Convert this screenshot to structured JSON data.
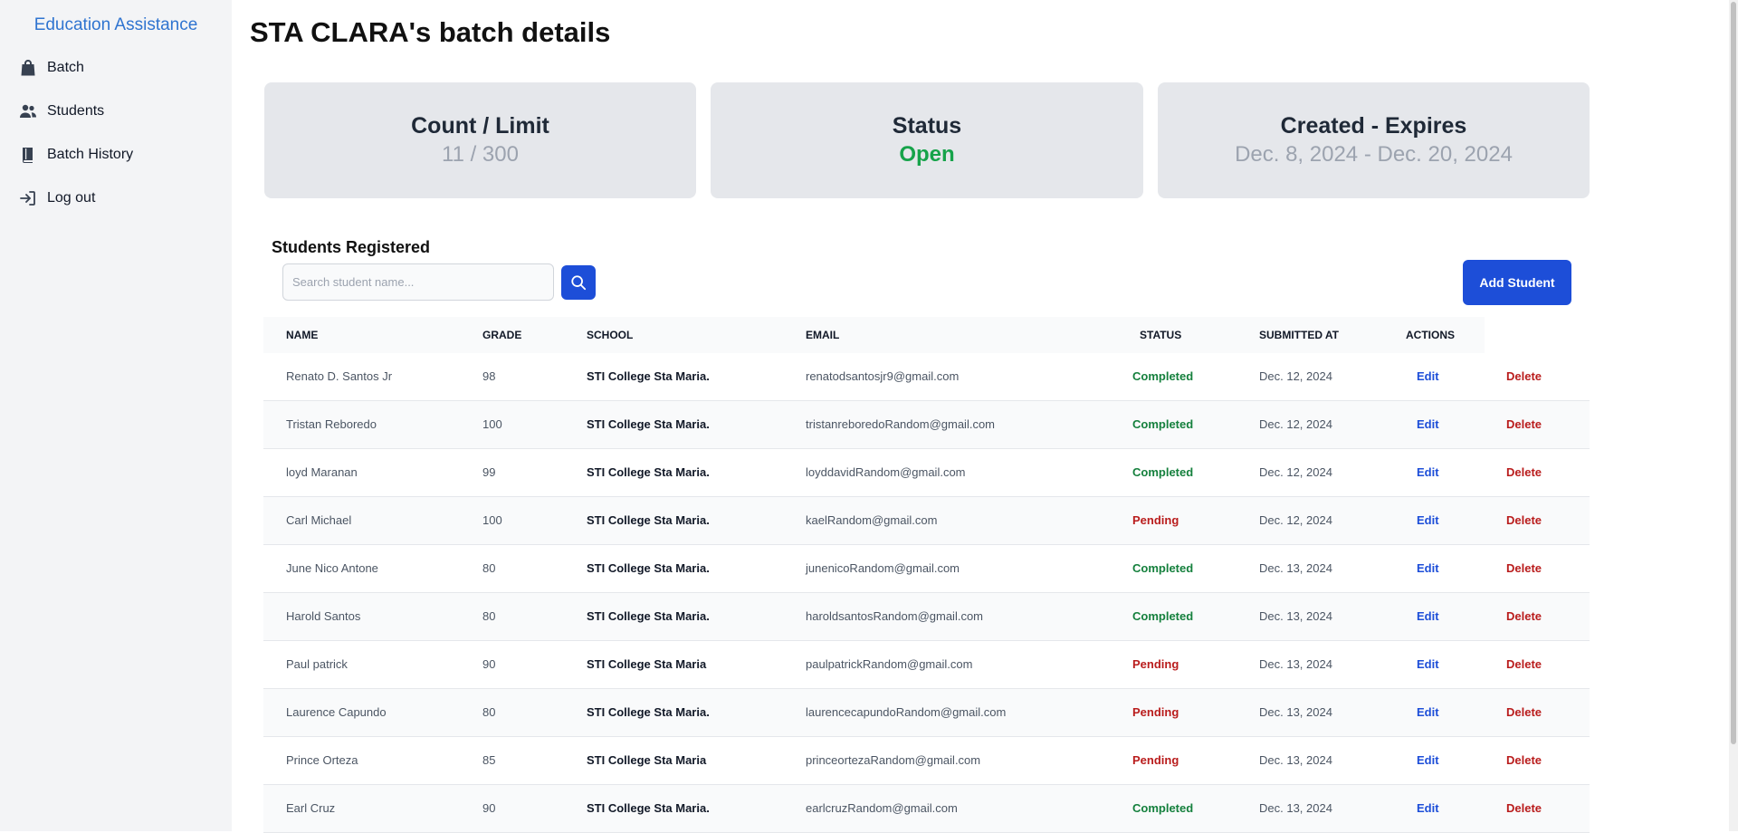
{
  "sidebar": {
    "brand": "Education Assistance",
    "items": [
      {
        "label": "Batch",
        "icon": "shopping-bag-icon"
      },
      {
        "label": "Students",
        "icon": "users-icon"
      },
      {
        "label": "Batch History",
        "icon": "book-icon"
      },
      {
        "label": "Log out",
        "icon": "logout-icon"
      }
    ]
  },
  "page": {
    "title": "STA CLARA's batch details"
  },
  "cards": [
    {
      "title": "Count / Limit",
      "value": "11 / 300"
    },
    {
      "title": "Status",
      "value": "Open"
    },
    {
      "title": "Created - Expires",
      "value": "Dec. 8, 2024 - Dec. 20, 2024"
    }
  ],
  "students": {
    "section_title": "Students Registered",
    "search_placeholder": "Search student name...",
    "add_button": "Add Student",
    "columns": [
      "NAME",
      "GRADE",
      "SCHOOL",
      "EMAIL",
      "STATUS",
      "SUBMITTED AT",
      "ACTIONS"
    ],
    "rows": [
      {
        "name": "Renato D. Santos Jr",
        "grade": "98",
        "school": "STI College Sta Maria.",
        "email": "renatodsantosjr9@gmail.com",
        "status": "Completed",
        "submitted": "Dec. 12, 2024",
        "edit": "Edit",
        "delete": "Delete"
      },
      {
        "name": "Tristan Reboredo",
        "grade": "100",
        "school": "STI College Sta Maria.",
        "email": "tristanreboredoRandom@gmail.com",
        "status": "Completed",
        "submitted": "Dec. 12, 2024",
        "edit": "Edit",
        "delete": "Delete"
      },
      {
        "name": "loyd Maranan",
        "grade": "99",
        "school": "STI College Sta Maria.",
        "email": "loyddavidRandom@gmail.com",
        "status": "Completed",
        "submitted": "Dec. 12, 2024",
        "edit": "Edit",
        "delete": "Delete"
      },
      {
        "name": "Carl Michael",
        "grade": "100",
        "school": "STI College Sta Maria.",
        "email": "kaelRandom@gmail.com",
        "status": "Pending",
        "submitted": "Dec. 12, 2024",
        "edit": "Edit",
        "delete": "Delete"
      },
      {
        "name": "June Nico Antone",
        "grade": "80",
        "school": "STI College Sta Maria.",
        "email": "junenicoRandom@gmail.com",
        "status": "Completed",
        "submitted": "Dec. 13, 2024",
        "edit": "Edit",
        "delete": "Delete"
      },
      {
        "name": "Harold Santos",
        "grade": "80",
        "school": "STI College Sta Maria.",
        "email": "haroldsantosRandom@gmail.com",
        "status": "Completed",
        "submitted": "Dec. 13, 2024",
        "edit": "Edit",
        "delete": "Delete"
      },
      {
        "name": "Paul patrick",
        "grade": "90",
        "school": "STI College Sta Maria",
        "email": "paulpatrickRandom@gmail.com",
        "status": "Pending",
        "submitted": "Dec. 13, 2024",
        "edit": "Edit",
        "delete": "Delete"
      },
      {
        "name": "Laurence Capundo",
        "grade": "80",
        "school": "STI College Sta Maria.",
        "email": "laurencecapundoRandom@gmail.com",
        "status": "Pending",
        "submitted": "Dec. 13, 2024",
        "edit": "Edit",
        "delete": "Delete"
      },
      {
        "name": "Prince Orteza",
        "grade": "85",
        "school": "STI College Sta Maria",
        "email": "princeortezaRandom@gmail.com",
        "status": "Pending",
        "submitted": "Dec. 13, 2024",
        "edit": "Edit",
        "delete": "Delete"
      },
      {
        "name": "Earl Cruz",
        "grade": "90",
        "school": "STI College Sta Maria.",
        "email": "earlcruzRandom@gmail.com",
        "status": "Completed",
        "submitted": "Dec. 13, 2024",
        "edit": "Edit",
        "delete": "Delete"
      }
    ]
  },
  "colors": {
    "accent": "#1d4ed8",
    "brand": "#2f74d0",
    "completed": "#15803d",
    "pending": "#b91c1c",
    "open": "#16a34a"
  }
}
